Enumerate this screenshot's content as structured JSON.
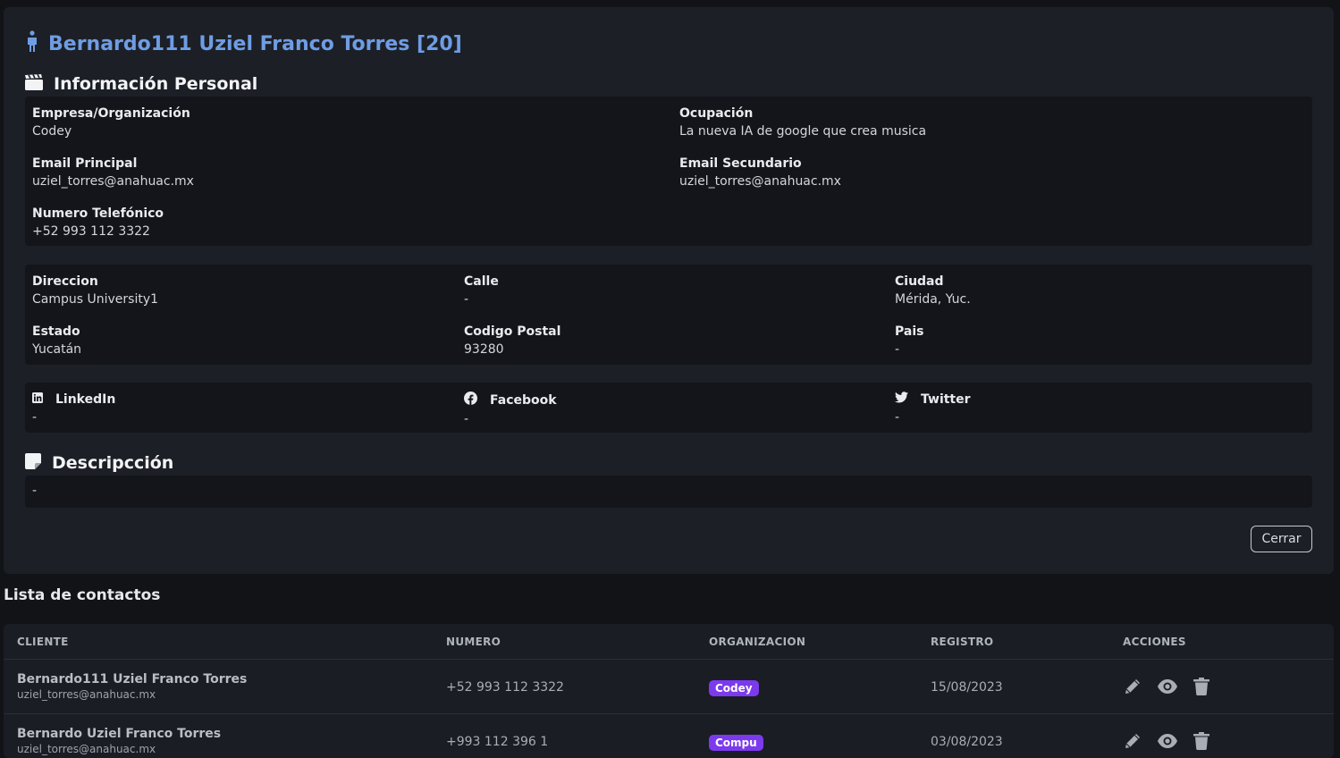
{
  "header": {
    "title": "Bernardo111 Uziel Franco Torres [20]"
  },
  "personal": {
    "heading": "Información Personal",
    "company_label": "Empresa/Organización",
    "company": "Codey",
    "occupation_label": "Ocupación",
    "occupation": "La nueva IA de google que crea musica",
    "email1_label": "Email Principal",
    "email1": "uziel_torres@anahuac.mx",
    "email2_label": "Email Secundario",
    "email2": "uziel_torres@anahuac.mx",
    "phone_label": "Numero Telefónico",
    "phone": "+52 993 112 3322"
  },
  "address": {
    "direccion_label": "Direccion",
    "direccion": "Campus University1",
    "calle_label": "Calle",
    "calle": "-",
    "ciudad_label": "Ciudad",
    "ciudad": "Mérida, Yuc.",
    "estado_label": "Estado",
    "estado": "Yucatán",
    "cp_label": "Codigo Postal",
    "cp": "93280",
    "pais_label": "Pais",
    "pais": "-"
  },
  "social": {
    "linkedin_label": "LinkedIn",
    "linkedin": "-",
    "facebook_label": "Facebook",
    "facebook": "-",
    "twitter_label": "Twitter",
    "twitter": "-"
  },
  "description": {
    "heading": "Descripcción",
    "text": "-"
  },
  "modal": {
    "close_label": "Cerrar"
  },
  "list": {
    "title": "Lista de contactos",
    "columns": [
      "CLIENTE",
      "NUMERO",
      "ORGANIZACION",
      "REGISTRO",
      "ACCIONES"
    ],
    "rows": [
      {
        "name": "Bernardo111 Uziel Franco Torres",
        "email": "uziel_torres@anahuac.mx",
        "number": "+52 993 112 3322",
        "org": "Codey",
        "date": "15/08/2023"
      },
      {
        "name": "Bernardo Uziel Franco Torres",
        "email": "uziel_torres@anahuac.mx",
        "number": "+993 112 396 1",
        "org": "Compu",
        "date": "03/08/2023"
      }
    ]
  },
  "colors": {
    "accent": "#6e9de4",
    "badge": "#7c3aed",
    "panel": "#1c1f26",
    "card": "#13151a"
  }
}
